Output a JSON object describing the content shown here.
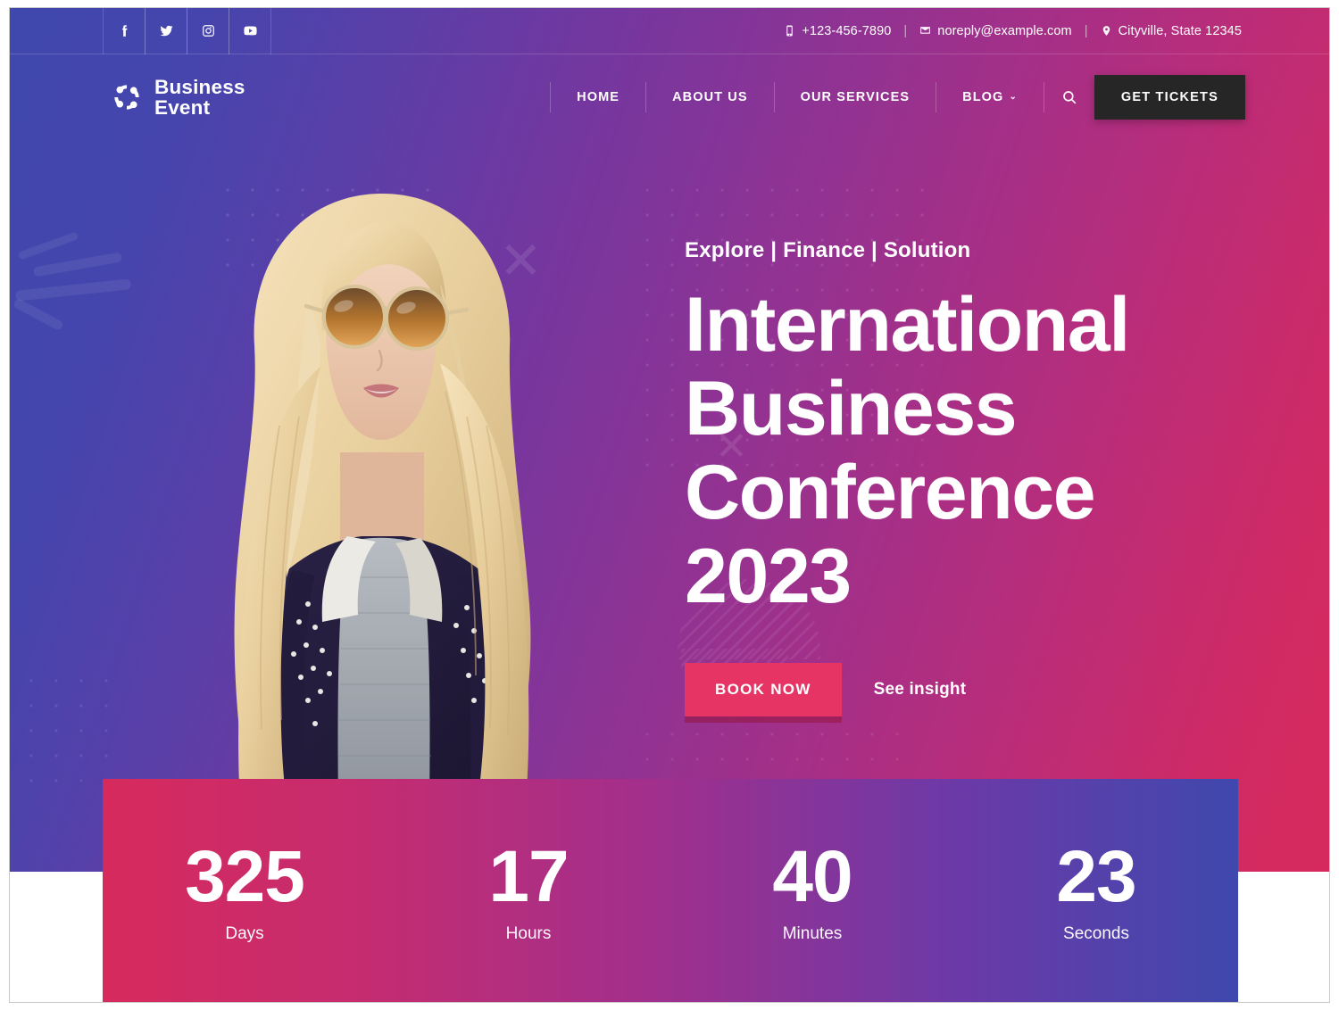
{
  "topbar": {
    "socials": [
      {
        "name": "facebook-icon",
        "label": "Facebook"
      },
      {
        "name": "twitter-icon",
        "label": "Twitter"
      },
      {
        "name": "instagram-icon",
        "label": "Instagram"
      },
      {
        "name": "youtube-icon",
        "label": "YouTube"
      }
    ],
    "phone": "+123-456-7890",
    "email": "noreply@example.com",
    "address": "Cityville, State 12345",
    "separator": "|"
  },
  "brand": {
    "line1": "Business",
    "line2": "Event",
    "logo_icon": "pinwheel-people-logo"
  },
  "nav": {
    "items": [
      {
        "label": "HOME",
        "has_dropdown": false
      },
      {
        "label": "ABOUT US",
        "has_dropdown": false
      },
      {
        "label": "OUR SERVICES",
        "has_dropdown": false
      },
      {
        "label": "BLOG",
        "has_dropdown": true
      }
    ],
    "caret": "⌄",
    "search_icon": "search-icon",
    "tickets_label": "GET TICKETS"
  },
  "hero": {
    "eyebrow": "Explore | Finance | Solution",
    "title_line1": "International",
    "title_line2": "Business",
    "title_line3": "Conference",
    "title_line4": "2023",
    "primary_cta": "BOOK NOW",
    "secondary_cta": "See insight",
    "photo_alt": "Smiling blonde woman wearing round sunglasses and a studded denim jacket"
  },
  "countdown": [
    {
      "value": "325",
      "label": "Days"
    },
    {
      "value": "17",
      "label": "Hours"
    },
    {
      "value": "40",
      "label": "Minutes"
    },
    {
      "value": "23",
      "label": "Seconds"
    }
  ],
  "colors": {
    "gradient_start": "#3f48ad",
    "gradient_end": "#d62a5d",
    "accent_pink": "#e63565",
    "tickets_dark": "#262626",
    "text_on_dark": "#ffffff"
  }
}
